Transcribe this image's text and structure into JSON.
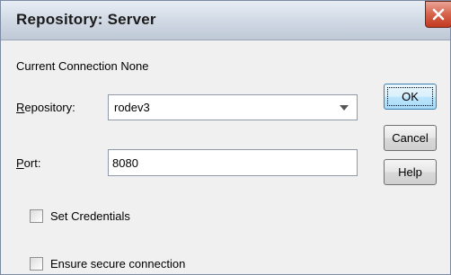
{
  "window": {
    "title": "Repository: Server",
    "close_icon": "close-icon"
  },
  "current_connection": "Current Connection None",
  "repository": {
    "label_underlined": "R",
    "label_rest": "epository:",
    "value": "rodev3",
    "dropdown_icon": "chevron-down-icon"
  },
  "port": {
    "label_underlined": "P",
    "label_rest": "ort:",
    "value": "8080"
  },
  "checkboxes": {
    "set_credentials": {
      "label": "Set Credentials",
      "checked": false
    },
    "ensure_secure": {
      "label": "Ensure secure connection",
      "checked": false
    }
  },
  "buttons": {
    "ok": "OK",
    "cancel": "Cancel",
    "help": "Help"
  },
  "colors": {
    "accent_default_button": "#3c7fb1",
    "close_button": "#c23a20",
    "dialog_background": "#f0f0f0"
  }
}
